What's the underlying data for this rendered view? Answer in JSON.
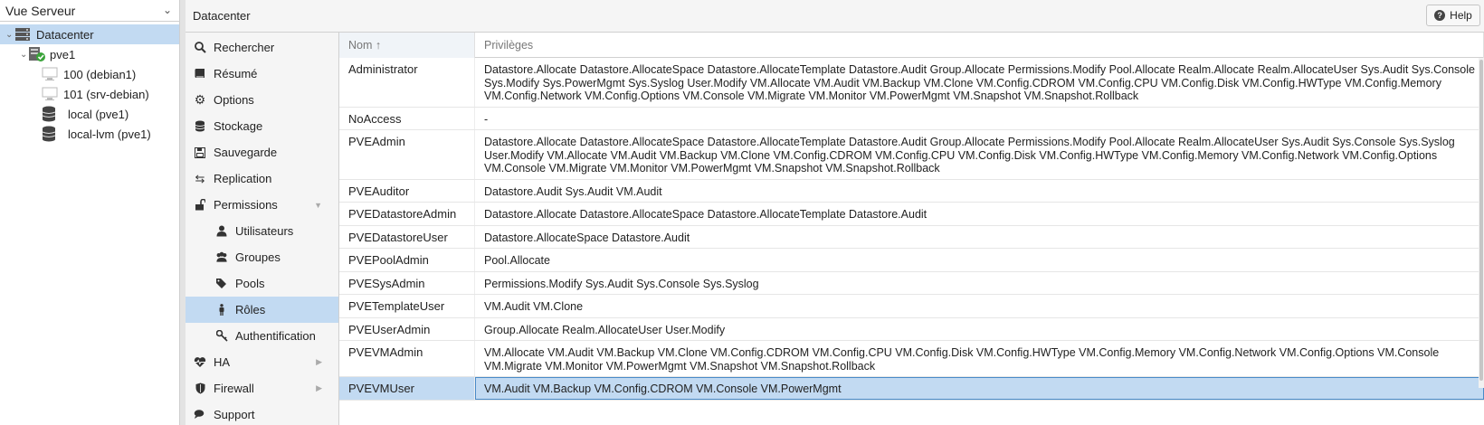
{
  "left_panel": {
    "view_select": "Vue Serveur",
    "tree": {
      "datacenter": "Datacenter",
      "node": "pve1",
      "vm1": "100 (debian1)",
      "vm2": "101 (srv-debian)",
      "storage1": "local (pve1)",
      "storage2": "local-lvm (pve1)"
    }
  },
  "header": {
    "title": "Datacenter",
    "help_label": "Help"
  },
  "menu": {
    "search": "Rechercher",
    "summary": "Résumé",
    "options": "Options",
    "storage": "Stockage",
    "backup": "Sauvegarde",
    "replication": "Replication",
    "permissions": "Permissions",
    "users": "Utilisateurs",
    "groups": "Groupes",
    "pools": "Pools",
    "roles": "Rôles",
    "auth": "Authentification",
    "ha": "HA",
    "firewall": "Firewall",
    "support": "Support"
  },
  "grid": {
    "col_name": "Nom ↑",
    "col_privileges": "Privilèges",
    "rows": [
      {
        "name": "Administrator",
        "privileges": "Datastore.Allocate Datastore.AllocateSpace Datastore.AllocateTemplate Datastore.Audit Group.Allocate Permissions.Modify Pool.Allocate Realm.Allocate Realm.AllocateUser Sys.Audit Sys.Console Sys.Modify Sys.PowerMgmt Sys.Syslog User.Modify VM.Allocate VM.Audit VM.Backup VM.Clone VM.Config.CDROM VM.Config.CPU VM.Config.Disk VM.Config.HWType VM.Config.Memory VM.Config.Network VM.Config.Options VM.Console VM.Migrate VM.Monitor VM.PowerMgmt VM.Snapshot VM.Snapshot.Rollback"
      },
      {
        "name": "NoAccess",
        "privileges": "-"
      },
      {
        "name": "PVEAdmin",
        "privileges": "Datastore.Allocate Datastore.AllocateSpace Datastore.AllocateTemplate Datastore.Audit Group.Allocate Permissions.Modify Pool.Allocate Realm.AllocateUser Sys.Audit Sys.Console Sys.Syslog User.Modify VM.Allocate VM.Audit VM.Backup VM.Clone VM.Config.CDROM VM.Config.CPU VM.Config.Disk VM.Config.HWType VM.Config.Memory VM.Config.Network VM.Config.Options VM.Console VM.Migrate VM.Monitor VM.PowerMgmt VM.Snapshot VM.Snapshot.Rollback"
      },
      {
        "name": "PVEAuditor",
        "privileges": "Datastore.Audit Sys.Audit VM.Audit"
      },
      {
        "name": "PVEDatastoreAdmin",
        "privileges": "Datastore.Allocate Datastore.AllocateSpace Datastore.AllocateTemplate Datastore.Audit"
      },
      {
        "name": "PVEDatastoreUser",
        "privileges": "Datastore.AllocateSpace Datastore.Audit"
      },
      {
        "name": "PVEPoolAdmin",
        "privileges": "Pool.Allocate"
      },
      {
        "name": "PVESysAdmin",
        "privileges": "Permissions.Modify Sys.Audit Sys.Console Sys.Syslog"
      },
      {
        "name": "PVETemplateUser",
        "privileges": "VM.Audit VM.Clone"
      },
      {
        "name": "PVEUserAdmin",
        "privileges": "Group.Allocate Realm.AllocateUser User.Modify"
      },
      {
        "name": "PVEVMAdmin",
        "privileges": "VM.Allocate VM.Audit VM.Backup VM.Clone VM.Config.CDROM VM.Config.CPU VM.Config.Disk VM.Config.HWType VM.Config.Memory VM.Config.Network VM.Config.Options VM.Console VM.Migrate VM.Monitor VM.PowerMgmt VM.Snapshot VM.Snapshot.Rollback"
      },
      {
        "name": "PVEVMUser",
        "privileges": "VM.Audit VM.Backup VM.Config.CDROM VM.Console VM.PowerMgmt"
      }
    ]
  },
  "colors": {
    "selection": "#c2daf2",
    "status_ok": "#3aa33a"
  }
}
